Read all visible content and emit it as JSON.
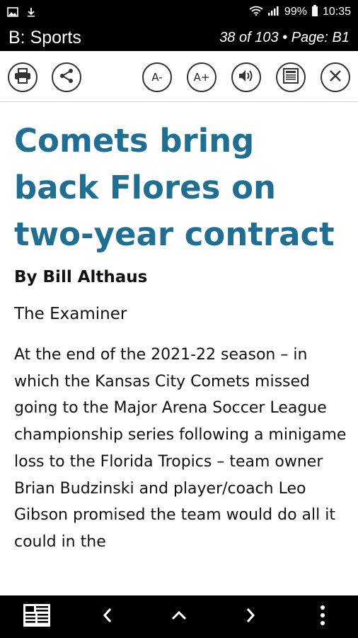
{
  "status_bar": {
    "battery": "99%",
    "time": "10:35",
    "icons": [
      "image-icon",
      "download-icon",
      "wifi-icon",
      "signal-icon",
      "battery-icon"
    ]
  },
  "header": {
    "section": "B: Sports",
    "page_info": "38 of 103 • Page: B1"
  },
  "toolbar": {
    "buttons": [
      {
        "name": "print-icon",
        "label": ""
      },
      {
        "name": "share-icon",
        "label": ""
      },
      {
        "name": "font-decrease-button",
        "label": "A-"
      },
      {
        "name": "font-increase-button",
        "label": "A+"
      },
      {
        "name": "speaker-icon",
        "label": ""
      },
      {
        "name": "page-view-icon",
        "label": ""
      },
      {
        "name": "close-icon",
        "label": ""
      }
    ]
  },
  "article": {
    "headline": "Comets bring back Flores on two-year contract",
    "byline": "By Bill Althaus",
    "source": "The Examiner",
    "body": "At the end of the 2021-22 season – in which the Kansas City Comets missed going to the Major Arena Soccer League championship series following a minigame loss to the Florida Tropics – team owner Brian Budzinski and player/coach Leo Gibson promised the team would do all it could in the"
  },
  "bottom_bar": {
    "icons": [
      "newspaper-icon",
      "chevron-left-icon",
      "chevron-up-icon",
      "chevron-right-icon",
      "more-vertical-icon"
    ]
  },
  "colors": {
    "headline": "#1f6e93",
    "bars": "#000000",
    "toolbar_bg": "#ffffff"
  }
}
